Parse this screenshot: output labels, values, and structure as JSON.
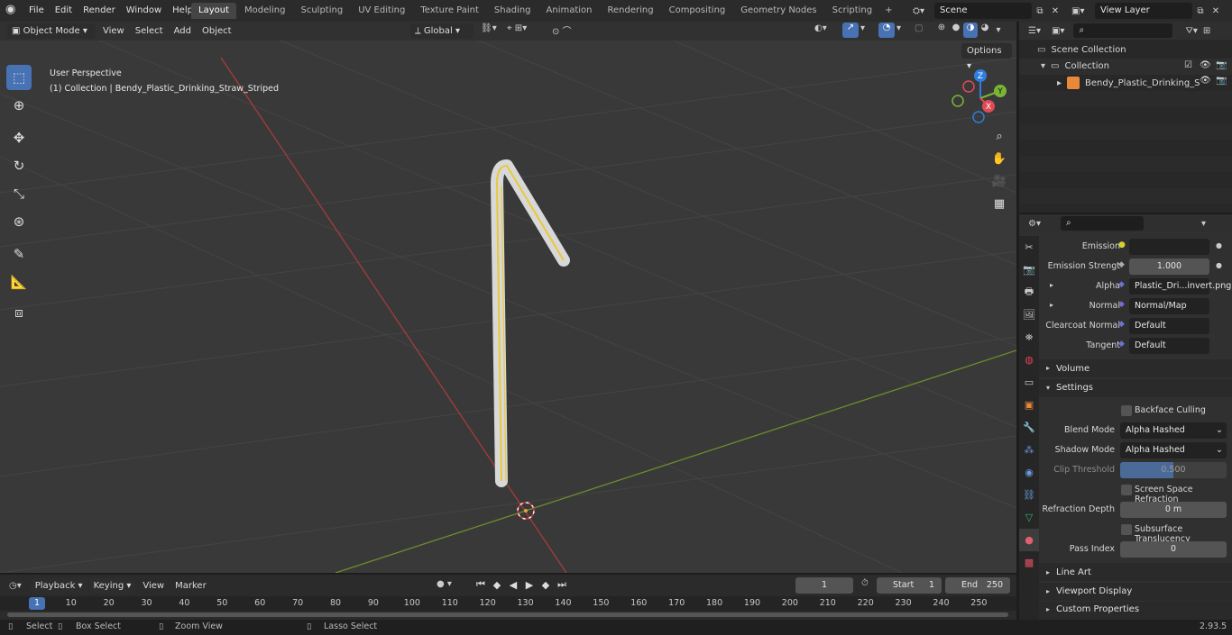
{
  "menus": [
    "File",
    "Edit",
    "Render",
    "Window",
    "Help"
  ],
  "workspaces": [
    "Layout",
    "Modeling",
    "Sculpting",
    "UV Editing",
    "Texture Paint",
    "Shading",
    "Animation",
    "Rendering",
    "Compositing",
    "Geometry Nodes",
    "Scripting"
  ],
  "active_workspace": "Layout",
  "scene_name": "Scene",
  "view_layer": "View Layer",
  "viewport": {
    "mode": "Object Mode",
    "menus": [
      "View",
      "Select",
      "Add",
      "Object"
    ],
    "transform": "Global",
    "options": "Options",
    "overlay_line1": "User Perspective",
    "overlay_line2": "(1) Collection | Bendy_Plastic_Drinking_Straw_Striped",
    "gizmo": {
      "z": "Z",
      "y": "Y",
      "x": "X"
    }
  },
  "outliner": {
    "scene_collection": "Scene Collection",
    "collection": "Collection",
    "object": "Bendy_Plastic_Drinking_S"
  },
  "properties": {
    "emission_label": "Emission",
    "emission_strength_label": "Emission Strengt",
    "emission_strength": "1.000",
    "alpha_label": "Alpha",
    "alpha_value": "Plastic_Dri...invert.png",
    "normal_label": "Normal",
    "normal_value": "Normal/Map",
    "clearcoat_label": "Clearcoat Normal",
    "clearcoat_value": "Default",
    "tangent_label": "Tangent",
    "tangent_value": "Default",
    "volume": "Volume",
    "settings": "Settings",
    "backface": "Backface Culling",
    "blend_label": "Blend Mode",
    "blend_value": "Alpha Hashed",
    "shadow_label": "Shadow Mode",
    "shadow_value": "Alpha Hashed",
    "clip_label": "Clip Threshold",
    "clip_value": "0.500",
    "ssr": "Screen Space Refraction",
    "refr_label": "Refraction Depth",
    "refr_value": "0 m",
    "sss": "Subsurface Translucency",
    "pass_label": "Pass Index",
    "pass_value": "0",
    "line_art": "Line Art",
    "viewport_display": "Viewport Display",
    "custom_props": "Custom Properties"
  },
  "timeline": {
    "menus": [
      "Playback",
      "Keying",
      "View",
      "Marker"
    ],
    "current_frame": "1",
    "start_label": "Start",
    "start": "1",
    "end_label": "End",
    "end": "250",
    "ticks": [
      "1",
      "10",
      "20",
      "30",
      "40",
      "50",
      "60",
      "70",
      "80",
      "90",
      "100",
      "110",
      "120",
      "130",
      "140",
      "150",
      "160",
      "170",
      "180",
      "190",
      "200",
      "210",
      "220",
      "230",
      "240",
      "250"
    ]
  },
  "status": {
    "select": "Select",
    "box_select": "Box Select",
    "zoom": "Zoom View",
    "lasso": "Lasso Select",
    "version": "2.93.5"
  },
  "colors": {
    "accent": "#4772b3",
    "active_tab": "#454545"
  }
}
